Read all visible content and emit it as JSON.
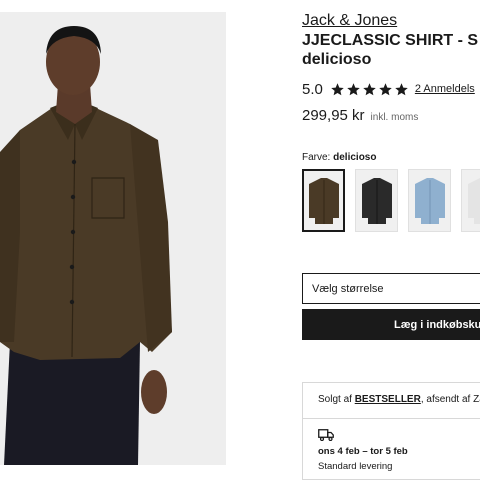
{
  "product": {
    "brand": "Jack & Jones",
    "title_line1": "JJECLASSIC SHIRT - S",
    "title_line2": "delicioso",
    "rating_value": "5.0",
    "rating_stars": 5,
    "reviews_text": "2 Anmeldels",
    "price": "299,95 kr",
    "vat_note": "inkl. moms"
  },
  "color": {
    "label": "Farve:",
    "selected_name": "delicioso",
    "swatches": [
      {
        "name": "delicioso",
        "color": "#4a3a26"
      },
      {
        "name": "black",
        "color": "#2a2a2a"
      },
      {
        "name": "light-blue",
        "color": "#8fb0cf"
      },
      {
        "name": "white",
        "color": "#e4e4e4"
      }
    ]
  },
  "size": {
    "placeholder": "Vælg størrelse"
  },
  "cart": {
    "button_label": "Læg i indkøbskur"
  },
  "seller": {
    "sold_by_prefix": "Solgt af",
    "seller_name": "BESTSELLER",
    "shipped_by": ", afsendt af Zalar",
    "delivery_date": "ons 4 feb – tor 5 feb",
    "delivery_type": "Standard levering"
  },
  "colors": {
    "shirt": "#4a3a26",
    "trousers": "#1a1a24",
    "background": "#eeeeee",
    "star": "#1a1a1a"
  }
}
